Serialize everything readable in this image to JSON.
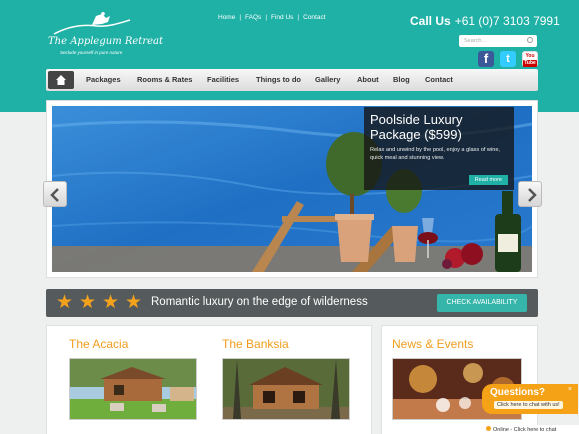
{
  "header": {
    "logo_name": "The Applegum Retreat",
    "logo_tagline": "Seclude yourself in pure nature",
    "toplinks": [
      "Home",
      "FAQs",
      "Find Us",
      "Contact"
    ],
    "call_label": "Call Us",
    "call_number": "+61 (0)7 3103 7991",
    "search_placeholder": "Search...",
    "social": {
      "facebook": "f",
      "twitter": "t",
      "youtube_top": "You",
      "youtube_bottom": "Tube"
    }
  },
  "nav": {
    "items": [
      "Packages",
      "Rooms & Rates",
      "Facilities",
      "Things to do",
      "Gallery",
      "About",
      "Blog",
      "Contact"
    ]
  },
  "hero": {
    "package_title": "Poolside Luxury Package ($599)",
    "package_text": "Relax and unwind by the pool, enjoy a glass of wine, quick meal and stunning view.",
    "read_more": "Read more"
  },
  "banner": {
    "text": "Romantic luxury on the edge of wilderness",
    "button": "CHECK AVAILABILITY",
    "stars": 4
  },
  "cards": {
    "acacia": "The Acacia",
    "banksia": "The Banksia",
    "news": "News & Events"
  },
  "chat": {
    "title": "Questions?",
    "subtitle": "Click here to chat with us!",
    "online": "Online - Click here to chat"
  },
  "colors": {
    "accent": "#1fb1a6",
    "orange": "#f09d1e",
    "banner": "#555b5c"
  }
}
